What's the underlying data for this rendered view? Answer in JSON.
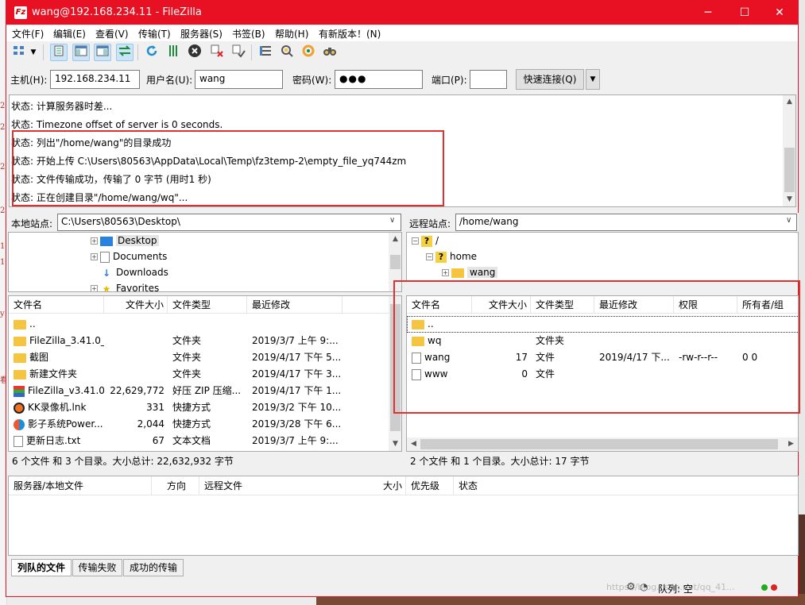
{
  "window": {
    "title": "wang@192.168.234.11 - FileZilla",
    "app_icon": "Fz",
    "minimize_icon": "─",
    "maximize_icon": "☐",
    "close_icon": "✕"
  },
  "menu": [
    "文件(F)",
    "编辑(E)",
    "查看(V)",
    "传输(T)",
    "服务器(S)",
    "书签(B)",
    "帮助(H)",
    "有新版本！(N)"
  ],
  "toolbar": {
    "icons": [
      "site-manager-icon",
      "site-manager-dropdown-icon",
      "toggle-message-log-icon",
      "toggle-local-tree-icon",
      "toggle-remote-tree-icon",
      "toggle-transfer-queue-icon",
      "refresh-icon",
      "process-queue-icon",
      "cancel-icon",
      "disconnect-icon",
      "reconnect-icon",
      "directory-filter-icon",
      "compare-icon",
      "synchronized-browsing-icon",
      "search-icon"
    ]
  },
  "quickconnect": {
    "host_label": "主机(H):",
    "host_value": "192.168.234.11",
    "user_label": "用户名(U):",
    "user_value": "wang",
    "pass_label": "密码(W):",
    "pass_value": "●●●",
    "port_label": "端口(P):",
    "port_value": "",
    "button": "快速连接(Q)",
    "dropdown": "▼"
  },
  "log": [
    "状态:  计算服务器时差...",
    "状态:  Timezone offset of server is 0 seconds.",
    "状态:  列出\"/home/wang\"的目录成功",
    "状态:  开始上传 C:\\Users\\80563\\AppData\\Local\\Temp\\fz3temp-2\\empty_file_yq744zm",
    "状态:  文件传输成功，传输了 0 字节 (用时1 秒)",
    "状态:  正在创建目录\"/home/wang/wq\"..."
  ],
  "local": {
    "site_label": "本地站点:",
    "path": "C:\\Users\\80563\\Desktop\\",
    "tree": [
      "Desktop",
      "Documents",
      "Downloads",
      "Favorites"
    ],
    "columns": [
      "文件名",
      "文件大小",
      "文件类型",
      "最近修改"
    ],
    "files": [
      {
        "name": "..",
        "size": "",
        "type": "",
        "modified": "",
        "icon": "folder-icon"
      },
      {
        "name": "FileZilla_3.41.0_...",
        "size": "",
        "type": "文件夹",
        "modified": "2019/3/7 上午 9:...",
        "icon": "folder-icon"
      },
      {
        "name": "截图",
        "size": "",
        "type": "文件夹",
        "modified": "2019/4/17 下午 5...",
        "icon": "folder-icon"
      },
      {
        "name": "新建文件夹",
        "size": "",
        "type": "文件夹",
        "modified": "2019/4/17 下午 3...",
        "icon": "folder-icon"
      },
      {
        "name": "FileZilla_v3.41.0...",
        "size": "22,629,772",
        "type": "好压 ZIP 压缩...",
        "modified": "2019/4/17 下午 1...",
        "icon": "zip-icon"
      },
      {
        "name": "KK录像机.lnk",
        "size": "331",
        "type": "快捷方式",
        "modified": "2019/3/2 下午 10...",
        "icon": "kk-recorder-icon"
      },
      {
        "name": "影子系统Power...",
        "size": "2,044",
        "type": "快捷方式",
        "modified": "2019/3/28 下午 6...",
        "icon": "shadow-system-icon"
      },
      {
        "name": "更新日志.txt",
        "size": "67",
        "type": "文本文档",
        "modified": "2019/3/7 上午 9:...",
        "icon": "text-file-icon"
      }
    ],
    "status": "6 个文件 和 3 个目录。大小总计: 22,632,932 字节"
  },
  "remote": {
    "site_label": "远程站点:",
    "path": "/home/wang",
    "tree": [
      "/",
      "home",
      "wang"
    ],
    "columns": [
      "文件名",
      "文件大小",
      "文件类型",
      "最近修改",
      "权限",
      "所有者/组"
    ],
    "files": [
      {
        "name": "..",
        "size": "",
        "type": "",
        "modified": "",
        "perm": "",
        "owner": "",
        "icon": "folder-icon"
      },
      {
        "name": "wq",
        "size": "",
        "type": "文件夹",
        "modified": "",
        "perm": "",
        "owner": "",
        "icon": "folder-icon"
      },
      {
        "name": "wang",
        "size": "17",
        "type": "文件",
        "modified": "2019/4/17 下...",
        "perm": "-rw-r--r--",
        "owner": "0 0",
        "icon": "file-icon"
      },
      {
        "name": "www",
        "size": "0",
        "type": "文件",
        "modified": "",
        "perm": "",
        "owner": "",
        "icon": "file-icon"
      }
    ],
    "status": "2 个文件 和 1 个目录。大小总计: 17 字节"
  },
  "queue": {
    "columns": [
      "服务器/本地文件",
      "方向",
      "远程文件",
      "大小",
      "优先级",
      "状态"
    ]
  },
  "tabs": [
    "列队的文件",
    "传输失败",
    "成功的传输"
  ],
  "statusbar": {
    "queue": "队列: 空",
    "watermark": "https://blog.csdn.net/qq_41..."
  },
  "colors": {
    "title_bar": "#e81123",
    "highlight": "#e03131",
    "folder": "#f5c542"
  }
}
